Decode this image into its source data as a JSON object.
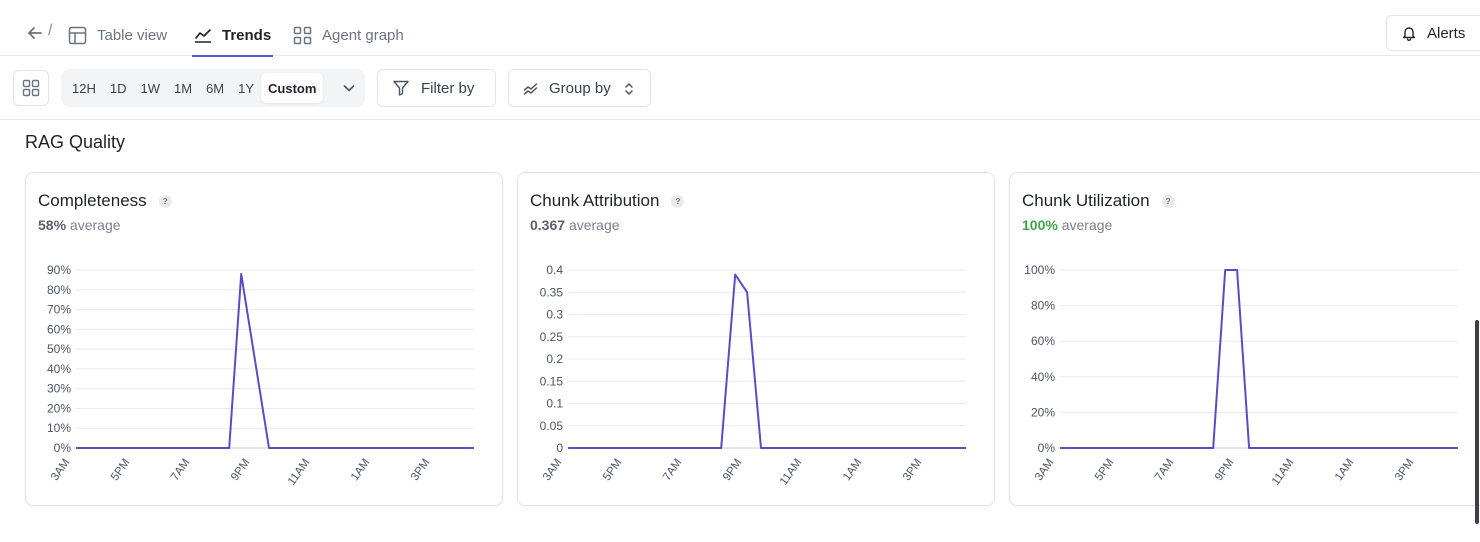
{
  "nav": {
    "breadcrumb_separator": "/",
    "tabs": [
      {
        "label": "Table view",
        "icon": "table-icon"
      },
      {
        "label": "Trends",
        "icon": "trend-line-icon",
        "active": true
      },
      {
        "label": "Agent graph",
        "icon": "graph-grid-icon"
      }
    ],
    "alerts_label": "Alerts"
  },
  "toolbar": {
    "ranges": [
      "12H",
      "1D",
      "1W",
      "1M",
      "6M",
      "1Y",
      "Custom"
    ],
    "selected_range": "Custom",
    "filter_label": "Filter by",
    "group_label": "Group by"
  },
  "section": {
    "title": "RAG Quality"
  },
  "colors": {
    "accent": "#4f5bd5",
    "line": "#5b4cc4",
    "good": "#3fa34d"
  },
  "x_ticks": [
    "3AM",
    "5PM",
    "7AM",
    "9PM",
    "11AM",
    "1AM",
    "3PM"
  ],
  "cards": [
    {
      "title": "Completeness",
      "average_value": "58%",
      "average_label": "average",
      "average_good": false,
      "chart_data": {
        "type": "line",
        "y_ticks": [
          "90%",
          "80%",
          "70%",
          "60%",
          "50%",
          "40%",
          "30%",
          "20%",
          "10%",
          "0%"
        ],
        "ylim": [
          0,
          90
        ],
        "x": [
          0,
          38.5,
          41.5,
          48.5,
          100
        ],
        "y": [
          0,
          0,
          88,
          0,
          0
        ]
      }
    },
    {
      "title": "Chunk Attribution",
      "average_value": "0.367",
      "average_label": "average",
      "average_good": false,
      "chart_data": {
        "type": "line",
        "y_ticks": [
          "0.4",
          "0.35",
          "0.3",
          "0.25",
          "0.2",
          "0.15",
          "0.1",
          "0.05",
          "0"
        ],
        "ylim": [
          0,
          0.4
        ],
        "x": [
          0,
          38.5,
          42,
          45,
          48.5,
          100
        ],
        "y": [
          0,
          0,
          0.39,
          0.35,
          0,
          0
        ]
      }
    },
    {
      "title": "Chunk Utilization",
      "average_value": "100%",
      "average_label": "average",
      "average_good": true,
      "chart_data": {
        "type": "line",
        "y_ticks": [
          "100%",
          "80%",
          "60%",
          "40%",
          "20%",
          "0%"
        ],
        "ylim": [
          0,
          100
        ],
        "x": [
          0,
          38.5,
          41.5,
          44.5,
          47.5,
          100
        ],
        "y": [
          0,
          0,
          100,
          100,
          0,
          0
        ]
      }
    }
  ]
}
